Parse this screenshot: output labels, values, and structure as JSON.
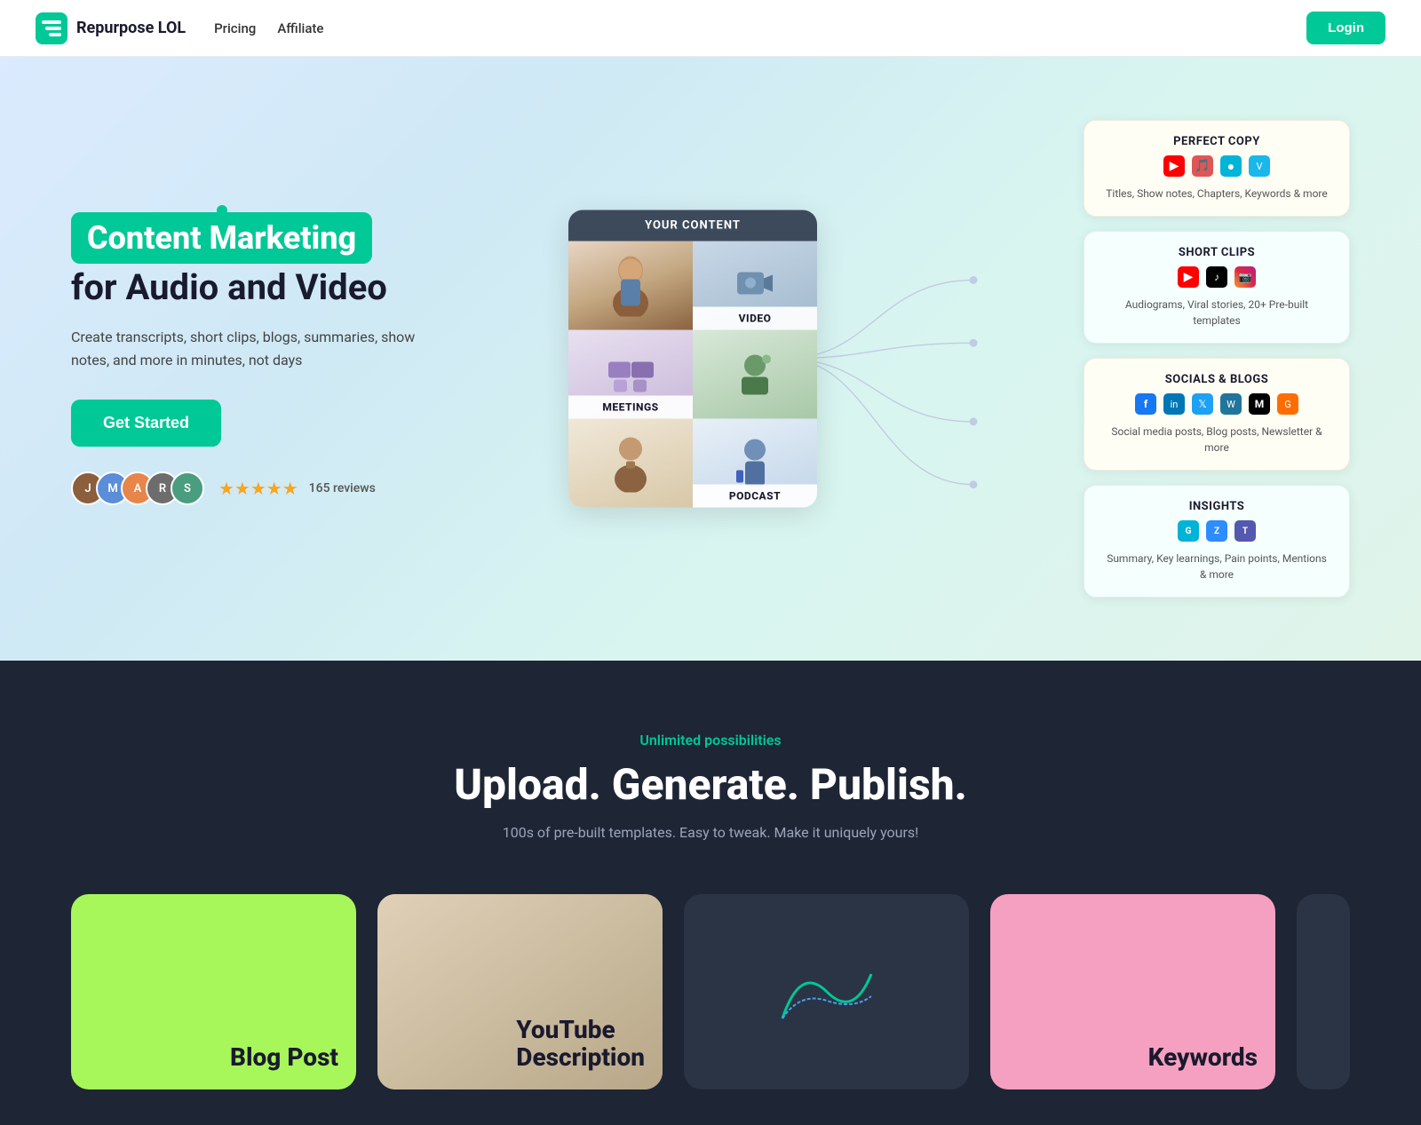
{
  "nav": {
    "logo_text": "Repurpose LOL",
    "links": [
      "Pricing",
      "Affiliate"
    ],
    "login_label": "Login"
  },
  "hero": {
    "badge_text": "Content Marketing",
    "headline": "for Audio and Video",
    "description": "Create transcripts, short clips, blogs, summaries, show notes, and more in minutes, not days",
    "cta_label": "Get Started",
    "reviews_count": "165 reviews",
    "stars": "★★★★★"
  },
  "content_card": {
    "header": "YOUR CONTENT",
    "cells": [
      {
        "label": ""
      },
      {
        "label": "VIDEO"
      },
      {
        "label": "MEETINGS"
      },
      {
        "label": ""
      },
      {
        "label": ""
      },
      {
        "label": "PODCAST"
      }
    ]
  },
  "feature_cards": [
    {
      "id": "perfect-copy",
      "title": "PERFECT COPY",
      "icons": [
        "yt",
        "fb",
        "tw",
        "vi"
      ],
      "desc": "Titles, Show notes, Chapters, Keywords & more"
    },
    {
      "id": "short-clips",
      "title": "SHORT CLIPS",
      "icons": [
        "yt",
        "tt",
        "ig"
      ],
      "desc": "Audiograms, Viral stories, 20+ Pre-built templates"
    },
    {
      "id": "socials-blogs",
      "title": "SOCIALS & BLOGS",
      "icons": [
        "fb",
        "li",
        "tw",
        "wp",
        "md",
        "gn"
      ],
      "desc": "Social media posts, Blog posts, Newsletter & more"
    },
    {
      "id": "insights",
      "title": "INSIGHTS",
      "icons": [
        "gr",
        "zo",
        "ms"
      ],
      "desc": "Summary, Key learnings, Pain points, Mentions & more"
    }
  ],
  "section2": {
    "subtitle": "Unlimited possibilities",
    "title": "Upload. Generate. Publish.",
    "desc": "100s of pre-built templates. Easy to tweak. Make it uniquely yours!",
    "cards": [
      {
        "label": "Blog Post",
        "bg": "#a8f75a",
        "text_color": "#1a1a2e"
      },
      {
        "label": "YouTube Description",
        "bg": "#c8b89a",
        "text_color": "#1a1a2e"
      },
      {
        "label": "Keywords",
        "bg": "#f5a0c0",
        "text_color": "#1a1a2e"
      },
      {
        "label": "",
        "bg": "#d4c8b0",
        "text_color": "#1a1a2e"
      }
    ]
  }
}
